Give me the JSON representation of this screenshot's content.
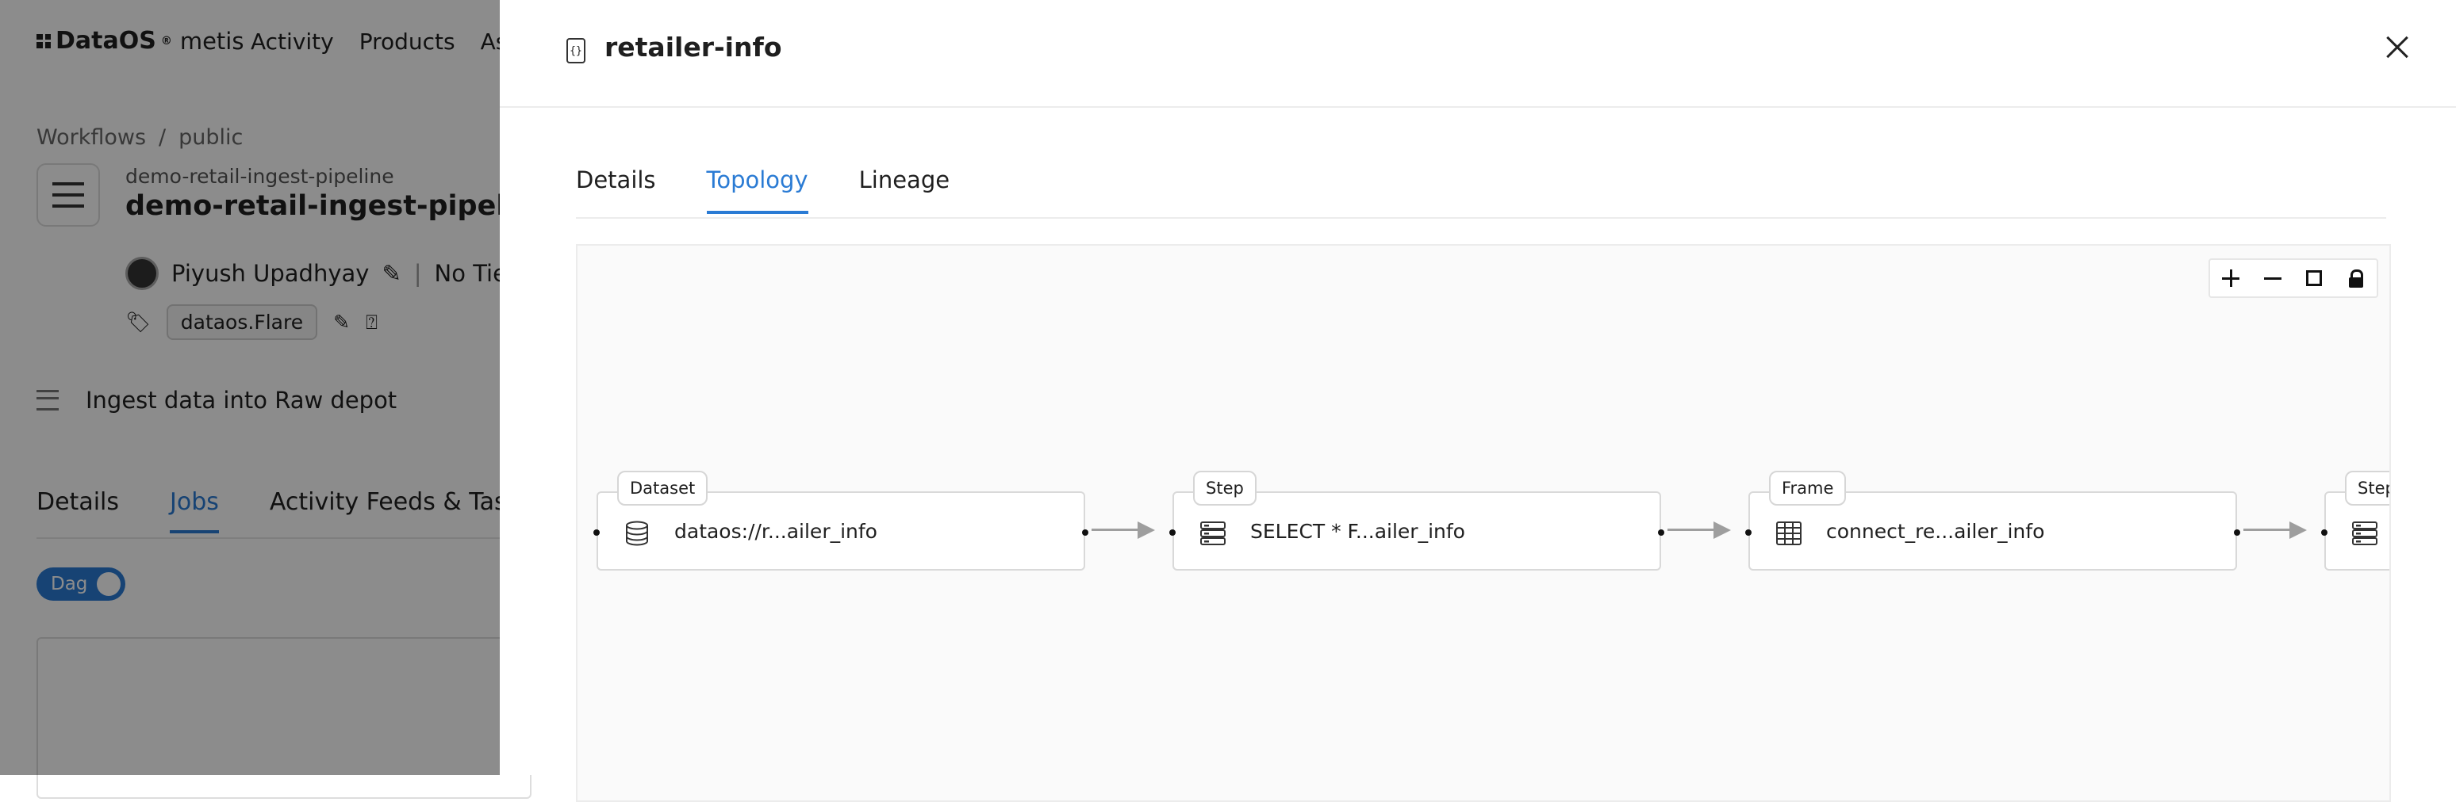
{
  "app": {
    "brand": "DataOS",
    "brand_sub": "metis",
    "nav": [
      "Activity",
      "Products",
      "Ass"
    ]
  },
  "background": {
    "breadcrumb": [
      "Workflows",
      "public"
    ],
    "workflow_subtitle": "demo-retail-ingest-pipeline",
    "workflow_title": "demo-retail-ingest-pipeline",
    "owner": "Piyush Upadhyay",
    "tier": "No Tier",
    "tag": "dataos.Flare",
    "description": "Ingest data into Raw depot",
    "tabs": [
      "Details",
      "Jobs",
      "Activity Feeds & Tasks"
    ],
    "active_tab": "Jobs",
    "toggle_label": "Dag"
  },
  "drawer": {
    "title": "retailer-info",
    "tabs": [
      "Details",
      "Topology",
      "Lineage"
    ],
    "active_tab": "Topology"
  },
  "topology": {
    "nodes": [
      {
        "badge": "Dataset",
        "label": "dataos://r...ailer_info",
        "icon": "database-icon"
      },
      {
        "badge": "Step",
        "label": "SELECT * F...ailer_info",
        "icon": "server-stack-icon"
      },
      {
        "badge": "Frame",
        "label": "connect_re...ailer_info",
        "icon": "table-icon"
      },
      {
        "badge": "Step",
        "label": "",
        "icon": "server-stack-icon"
      }
    ],
    "controls": [
      "zoom-in",
      "zoom-out",
      "fit-view",
      "lock"
    ]
  },
  "colors": {
    "accent": "#2a7bd4",
    "overlay": "rgba(0,0,0,0.45)",
    "edge": "#9e9e9e"
  }
}
